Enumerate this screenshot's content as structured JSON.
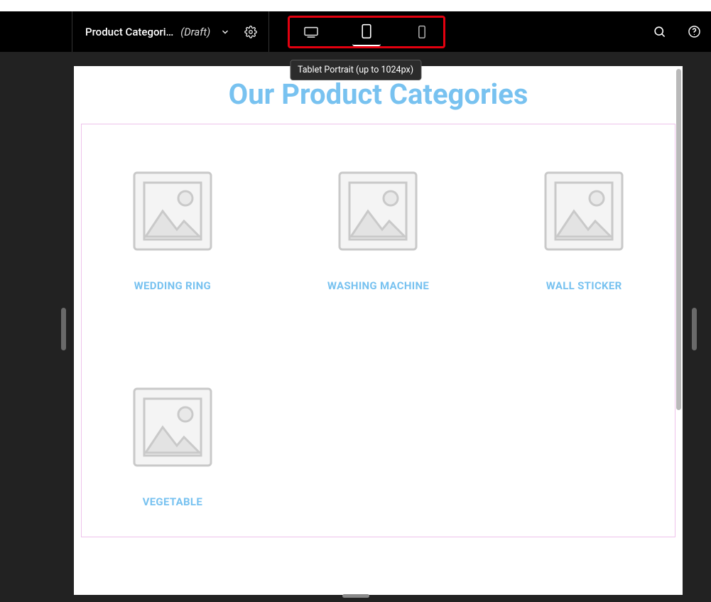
{
  "header": {
    "title": "Product Categori…",
    "status": "(Draft)"
  },
  "tooltip": "Tablet Portrait (up to 1024px)",
  "page": {
    "heading": "Our Product Categories",
    "categories": [
      {
        "label": "WEDDING RING"
      },
      {
        "label": "WASHING MACHINE"
      },
      {
        "label": "WALL STICKER"
      },
      {
        "label": "VEGETABLE"
      }
    ]
  }
}
